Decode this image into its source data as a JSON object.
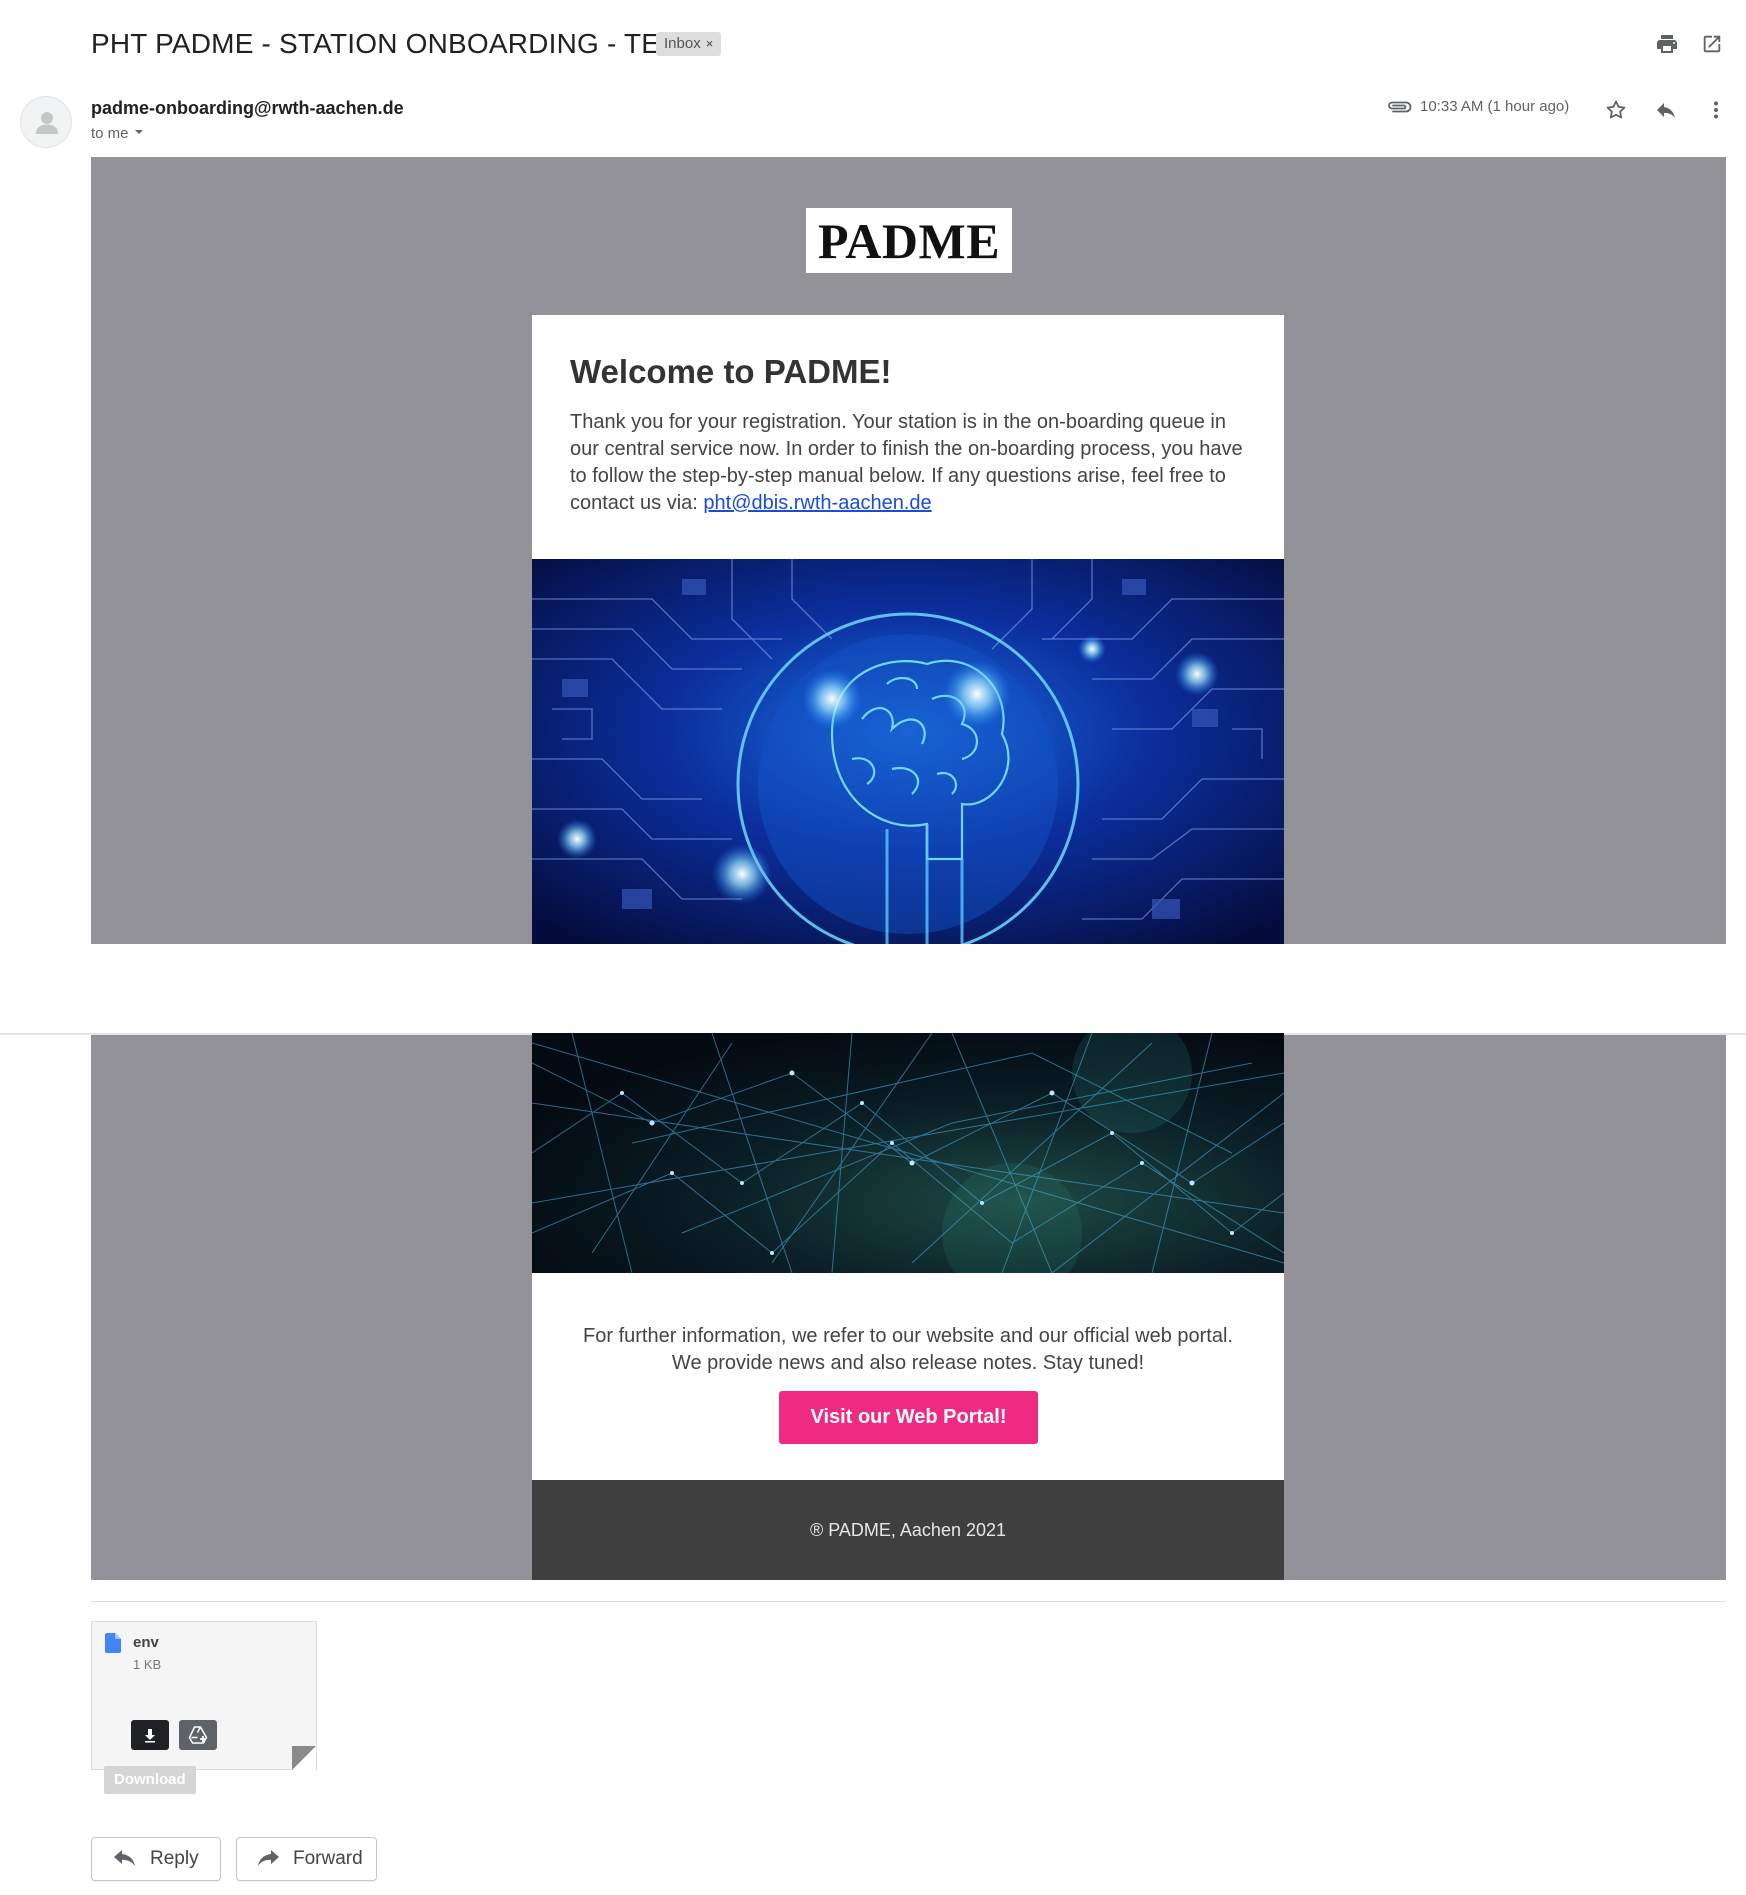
{
  "email": {
    "subject": "PHT PADME - STATION ONBOARDING - TEST",
    "label_chip": "Inbox",
    "label_remove": "×",
    "sender": "padme-onboarding@rwth-aachen.de",
    "recipient": "to me",
    "time": "10:33 AM (1 hour ago)",
    "icons": {
      "print": "printer-icon",
      "new_window": "open-in-new-window-icon",
      "attachment": "paperclip-icon",
      "star": "star-icon",
      "reply": "reply-icon",
      "more": "more-vert-icon"
    }
  },
  "body": {
    "logo_text": "PADME",
    "welcome_title": "Welcome to PADME!",
    "intro_text": "Thank you for your registration. Your station is in the on-boarding queue in our central service now. In order to finish the on-boarding process, you have to follow the step-by-step manual below. If any questions arise, feel free to contact us via: ",
    "contact_email": "pht@dbis.rwth-aachen.de",
    "further_line1": "For further information, we refer to our website and our official web portal.",
    "further_line2": "We provide news and also release notes. Stay tuned!",
    "portal_button": "Visit our Web Portal!",
    "footer": "® PADME, Aachen 2021",
    "colors": {
      "band": "#939298",
      "button": "#ef2a82",
      "footer": "#3f3f3f",
      "link": "#1a4cd6"
    }
  },
  "attachment": {
    "name": "env",
    "size": "1 KB",
    "download_tooltip": "Download",
    "icons": {
      "file": "document-icon",
      "download": "download-icon",
      "drive": "add-to-drive-icon"
    }
  },
  "actions": {
    "reply": "Reply",
    "forward": "Forward"
  }
}
